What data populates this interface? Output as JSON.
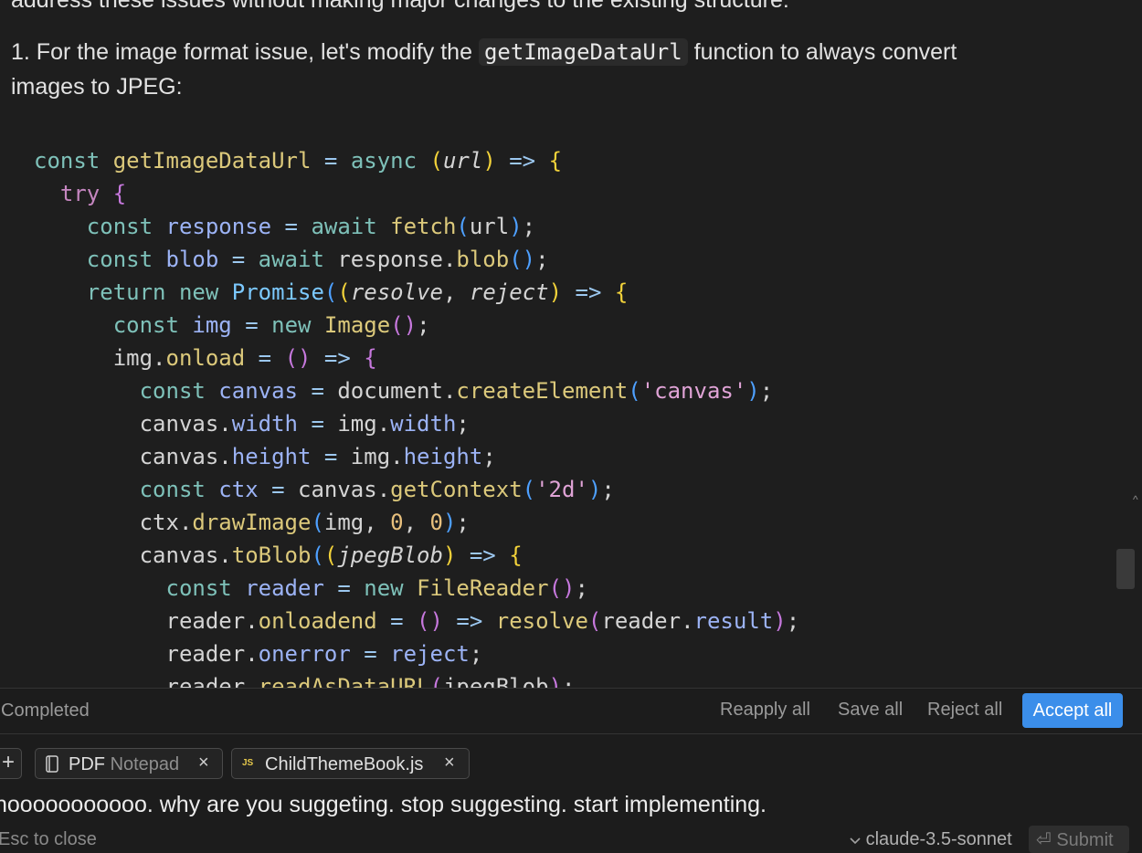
{
  "chat": {
    "top_text": "address these issues without making major changes to the existing structure:",
    "para1_before": "1. For the image format issue, let's modify the ",
    "para1_code": "getImageDataUrl",
    "para1_after": " function to always convert",
    "para2": "images to JPEG:",
    "code_language": "javascript"
  },
  "status": {
    "text": "Completed",
    "reapply_label": "Reapply all",
    "save_label": "Save all",
    "reject_label": "Reject all",
    "accept_label": "Accept all",
    "accent_color": "#3b8eea"
  },
  "composer": {
    "add_label": "+",
    "chips": [
      {
        "label": "PDF",
        "sublabel": "Notepad",
        "icon": "notebook-icon"
      },
      {
        "label": "ChildThemeBook.js",
        "icon": "js-file-icon",
        "badge": "JS"
      }
    ],
    "close_glyph": "×",
    "input_text": "nooooooooooo. why are you suggeting. stop suggesting. start implementing.",
    "esc_hint": "Esc to close",
    "model": "claude-3.5-sonnet",
    "submit_label": "Submit"
  }
}
